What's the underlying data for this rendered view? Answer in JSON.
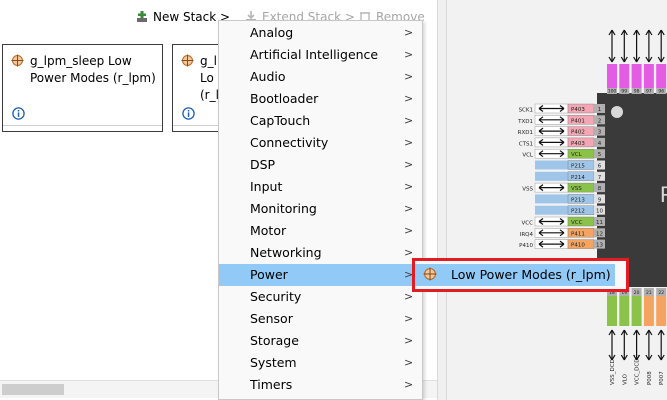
{
  "toolbar": {
    "new_stack": "New Stack >",
    "extend_stack": "Extend Stack >",
    "remove": "Remove"
  },
  "stacks": [
    {
      "line1": "g_lpm_sleep Low",
      "line2": "Power Modes (r_lpm)"
    },
    {
      "line1": "g_l",
      "line2": "Lo",
      "line3": "(r_l"
    }
  ],
  "menu": {
    "items": [
      {
        "label": "Analog"
      },
      {
        "label": "Artificial Intelligence"
      },
      {
        "label": "Audio"
      },
      {
        "label": "Bootloader"
      },
      {
        "label": "CapTouch"
      },
      {
        "label": "Connectivity"
      },
      {
        "label": "DSP"
      },
      {
        "label": "Input"
      },
      {
        "label": "Monitoring"
      },
      {
        "label": "Motor"
      },
      {
        "label": "Networking"
      },
      {
        "label": "Power"
      },
      {
        "label": "Security"
      },
      {
        "label": "Sensor"
      },
      {
        "label": "Storage"
      },
      {
        "label": "System"
      },
      {
        "label": "Timers"
      }
    ],
    "arrow": ">",
    "active_index": 11
  },
  "submenu": {
    "item": "Low Power Modes (r_lpm)"
  },
  "pins": {
    "left_signals": [
      "SCK1",
      "TXD1",
      "RXD1",
      "CTS1",
      "VCL",
      "",
      "",
      "VSS",
      "",
      "",
      "VCC",
      "IRQ4",
      "P410"
    ],
    "left_pins": [
      "P403",
      "P401",
      "P402",
      "P403",
      "VCL",
      "P215",
      "P214",
      "VSS",
      "P213",
      "P212",
      "VCC",
      "P411",
      "P410"
    ],
    "left_numbers": [
      "1",
      "2",
      "3",
      "4",
      "5",
      "6",
      "7",
      "8",
      "9",
      "10",
      "11",
      "12",
      "13"
    ],
    "top_numbers": [
      "100",
      "99",
      "98",
      "97",
      "96",
      "95"
    ],
    "bottom_numbers": [
      "18",
      "19",
      "20",
      "21",
      "22",
      "23"
    ],
    "bottom_labels": [
      "VSS_DCDC",
      "VLO",
      "VCC_DCDC",
      "P008",
      "P007",
      "P006"
    ],
    "chip_text": "R"
  },
  "colors": {
    "menu_highlight": "#91c9f7",
    "callout": "#e21c23"
  }
}
